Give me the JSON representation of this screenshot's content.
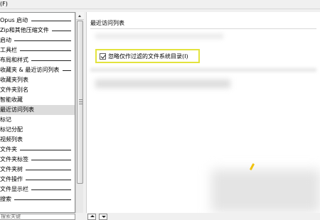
{
  "menubar": {
    "first_menu": "(F)"
  },
  "sidebar": {
    "items": [
      {
        "label": "Opus 启动",
        "connector": true
      },
      {
        "label": "Zip和其他压缩文件",
        "connector": true
      },
      {
        "label": "启动",
        "connector": true
      },
      {
        "label": "工具栏",
        "connector": true
      },
      {
        "label": "布局和样式",
        "connector": true
      },
      {
        "label": "收藏夹 & 最近访问列表",
        "connector": true
      },
      {
        "label": "收藏夹列表",
        "connector": false
      },
      {
        "label": "文件夹别名",
        "connector": false
      },
      {
        "label": "智能收藏",
        "connector": false
      },
      {
        "label": "最近访问列表",
        "connector": false,
        "selected": true
      },
      {
        "label": "标记",
        "connector": false
      },
      {
        "label": "标记分配",
        "connector": false
      },
      {
        "label": "视频列表",
        "connector": false
      },
      {
        "label": "文件夹",
        "connector": true
      },
      {
        "label": "文件夹标签",
        "connector": true
      },
      {
        "label": "文件夹树",
        "connector": true
      },
      {
        "label": "文件操作",
        "connector": true
      },
      {
        "label": "文件显示栏",
        "connector": true
      },
      {
        "label": "搜索",
        "connector": true
      }
    ]
  },
  "bottom": {
    "search_text": "搜索关键",
    "up_button": "up",
    "down_button": "down"
  },
  "panel": {
    "title": "最近访问列表",
    "option": {
      "label": "忽略仅作过滤的文件系统目录(I)",
      "checked": true
    }
  },
  "colors": {
    "highlight_border": "#e3e33e",
    "selected_item": "#dcdcdc"
  }
}
